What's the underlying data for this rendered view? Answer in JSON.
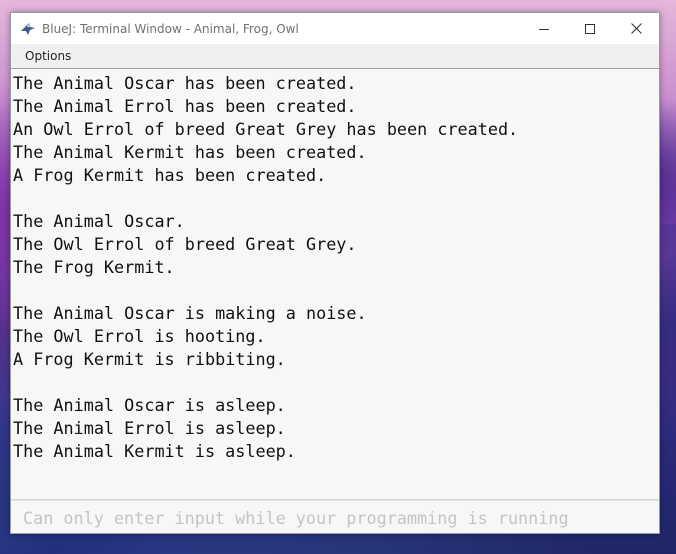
{
  "window": {
    "title": "BlueJ: Terminal Window - Animal, Frog, Owl",
    "controls": {
      "minimize": "minimize-icon",
      "maximize": "maximize-icon",
      "close": "close-icon"
    }
  },
  "menubar": {
    "items": [
      "Options"
    ]
  },
  "console": {
    "lines": [
      "The Animal Oscar has been created.",
      "The Animal Errol has been created.",
      "An Owl Errol of breed Great Grey has been created.",
      "The Animal Kermit has been created.",
      "A Frog Kermit has been created.",
      "",
      "The Animal Oscar.",
      "The Owl Errol of breed Great Grey.",
      "The Frog Kermit.",
      "",
      "The Animal Oscar is making a noise.",
      "The Owl Errol is hooting.",
      "A Frog Kermit is ribbiting.",
      "",
      "The Animal Oscar is asleep.",
      "The Animal Errol is asleep.",
      "The Animal Kermit is asleep."
    ]
  },
  "input": {
    "placeholder": "Can only enter input while your programming is running",
    "value": ""
  },
  "colors": {
    "console_bg": "#f7f7f7",
    "menubar_bg": "#f0f0f0",
    "text": "#111111",
    "placeholder": "#c4c4c4"
  }
}
